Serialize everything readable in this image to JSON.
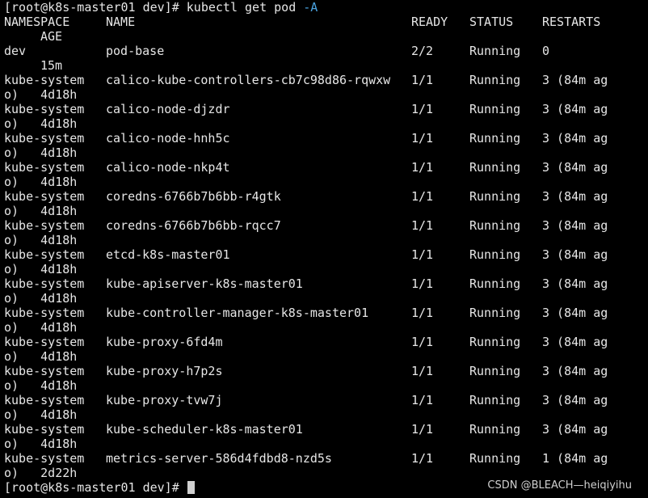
{
  "prompt": {
    "first": "[root@k8s-master01 dev]# ",
    "command": "kubectl get pod ",
    "flag": "-A",
    "last": "[root@k8s-master01 dev]# "
  },
  "headers": {
    "namespace": "NAMESPACE",
    "name": "NAME",
    "ready": "READY",
    "status": "STATUS",
    "restarts": "RESTARTS",
    "age": "AGE"
  },
  "rows": [
    {
      "ns": "dev",
      "name": "pod-base",
      "ready": "2/2",
      "status": "Running",
      "restarts": "0",
      "age_wrap": "15m"
    },
    {
      "ns": "kube-system",
      "name": "calico-kube-controllers-cb7c98d86-rqwxw",
      "ready": "1/1",
      "status": "Running",
      "restarts": "3 (84m ag",
      "age_wrap": "o)   4d18h"
    },
    {
      "ns": "kube-system",
      "name": "calico-node-djzdr",
      "ready": "1/1",
      "status": "Running",
      "restarts": "3 (84m ag",
      "age_wrap": "o)   4d18h"
    },
    {
      "ns": "kube-system",
      "name": "calico-node-hnh5c",
      "ready": "1/1",
      "status": "Running",
      "restarts": "3 (84m ag",
      "age_wrap": "o)   4d18h"
    },
    {
      "ns": "kube-system",
      "name": "calico-node-nkp4t",
      "ready": "1/1",
      "status": "Running",
      "restarts": "3 (84m ag",
      "age_wrap": "o)   4d18h"
    },
    {
      "ns": "kube-system",
      "name": "coredns-6766b7b6bb-r4gtk",
      "ready": "1/1",
      "status": "Running",
      "restarts": "3 (84m ag",
      "age_wrap": "o)   4d18h"
    },
    {
      "ns": "kube-system",
      "name": "coredns-6766b7b6bb-rqcc7",
      "ready": "1/1",
      "status": "Running",
      "restarts": "3 (84m ag",
      "age_wrap": "o)   4d18h"
    },
    {
      "ns": "kube-system",
      "name": "etcd-k8s-master01",
      "ready": "1/1",
      "status": "Running",
      "restarts": "3 (84m ag",
      "age_wrap": "o)   4d18h"
    },
    {
      "ns": "kube-system",
      "name": "kube-apiserver-k8s-master01",
      "ready": "1/1",
      "status": "Running",
      "restarts": "3 (84m ag",
      "age_wrap": "o)   4d18h"
    },
    {
      "ns": "kube-system",
      "name": "kube-controller-manager-k8s-master01",
      "ready": "1/1",
      "status": "Running",
      "restarts": "3 (84m ag",
      "age_wrap": "o)   4d18h"
    },
    {
      "ns": "kube-system",
      "name": "kube-proxy-6fd4m",
      "ready": "1/1",
      "status": "Running",
      "restarts": "3 (84m ag",
      "age_wrap": "o)   4d18h"
    },
    {
      "ns": "kube-system",
      "name": "kube-proxy-h7p2s",
      "ready": "1/1",
      "status": "Running",
      "restarts": "3 (84m ag",
      "age_wrap": "o)   4d18h"
    },
    {
      "ns": "kube-system",
      "name": "kube-proxy-tvw7j",
      "ready": "1/1",
      "status": "Running",
      "restarts": "3 (84m ag",
      "age_wrap": "o)   4d18h"
    },
    {
      "ns": "kube-system",
      "name": "kube-scheduler-k8s-master01",
      "ready": "1/1",
      "status": "Running",
      "restarts": "3 (84m ag",
      "age_wrap": "o)   4d18h"
    },
    {
      "ns": "kube-system",
      "name": "metrics-server-586d4fdbd8-nzd5s",
      "ready": "1/1",
      "status": "Running",
      "restarts": "1 (84m ag",
      "age_wrap": "o)   2d22h"
    }
  ],
  "watermark": "CSDN @BLEACH—heiqiyihu",
  "colors": {
    "background": "#000000",
    "text": "#e6e6e6",
    "flag": "#4aa3e0",
    "cursor": "#d0d0d0"
  }
}
